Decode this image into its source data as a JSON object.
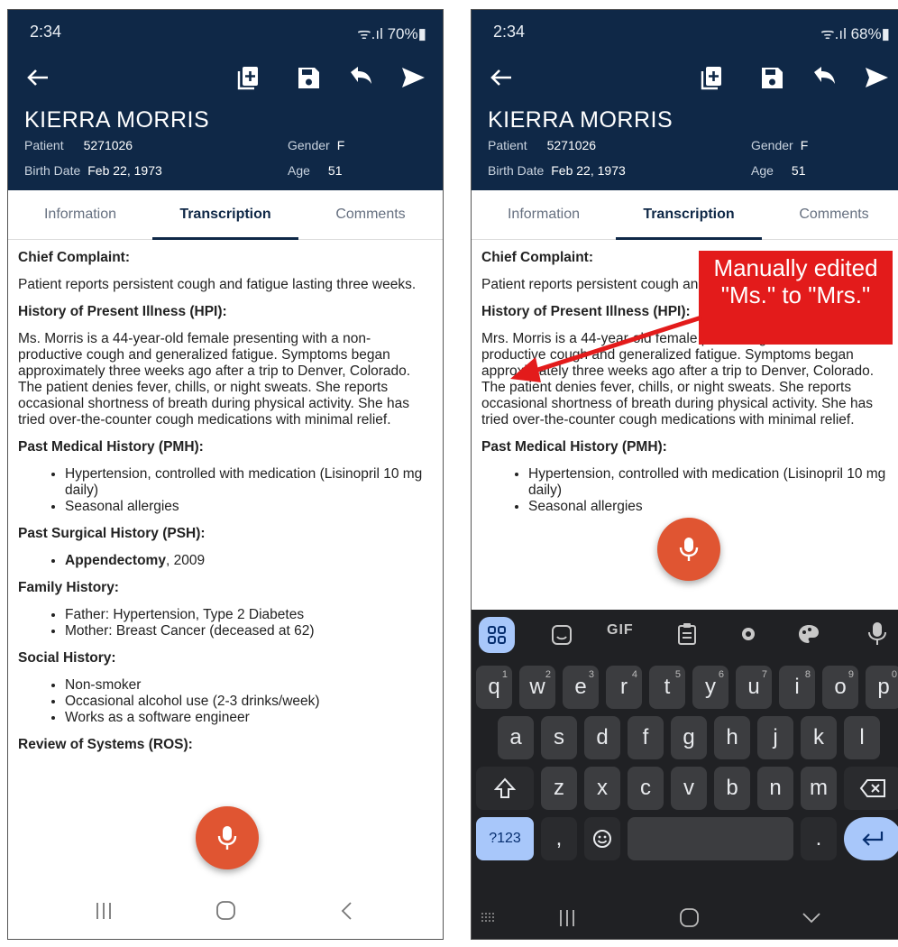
{
  "left": {
    "status": {
      "time": "2:34",
      "signal": "ᯤ.ıl 70%▮"
    },
    "fab_label": "Voice input"
  },
  "right": {
    "status": {
      "time": "2:34",
      "signal": "ᯤ.ıl 68%▮"
    }
  },
  "patient": {
    "name": "KIERRA MORRIS",
    "patient_label": "Patient",
    "patient_id": "5271026",
    "gender_label": "Gender",
    "gender": "F",
    "birth_label": "Birth Date",
    "birth_date": "Feb 22, 1973",
    "age_label": "Age",
    "age": "51"
  },
  "tabs": [
    "Information",
    "Transcription",
    "Comments"
  ],
  "note": {
    "cc_h": "Chief Complaint:",
    "cc": "Patient reports persistent cough and fatigue lasting three weeks.",
    "hpi_h": "History of Present Illness (HPI):",
    "hpi": "Ms. Morris is a 44-year-old female presenting with a non-productive cough and generalized fatigue. Symptoms began approximately three weeks ago after a trip to Denver, Colorado. The patient denies fever, chills, or night sweats. She reports occasional shortness of breath during physical activity. She has tried over-the-counter cough medications with minimal relief.",
    "hpi_edited": "Mrs. Morris is a 44-year-old female presenting with a non-productive cough and generalized fatigue. Symptoms began approximately three weeks ago after a trip to Denver, Colorado. The patient denies fever, chills, or night sweats. She reports occasional shortness of breath during physical activity. She has tried over-the-counter cough medications with minimal relief.",
    "pmh_h": "Past Medical History (PMH):",
    "pmh": [
      "Hypertension, controlled with medication (Lisinopril 10 mg daily)",
      "Seasonal allergies"
    ],
    "psh_h": "Past Surgical History (PSH):",
    "psh_bold": "Appendectomy",
    "psh_rest": ", 2009",
    "fh_h": "Family History:",
    "fh": [
      "Father: Hypertension, Type 2 Diabetes",
      "Mother: Breast Cancer (deceased at 62)"
    ],
    "sh_h": "Social History:",
    "sh": [
      "Non-smoker",
      "Occasional alcohol use (2-3 drinks/week)",
      "Works as a software engineer"
    ],
    "ros_h": "Review of Systems (ROS):"
  },
  "keyboard": {
    "toolbar": [
      "apps-grid",
      "sticker",
      "GIF",
      "clipboard",
      "settings",
      "palette",
      "mic"
    ],
    "gif_label": "GIF",
    "row1": [
      [
        "q",
        "1"
      ],
      [
        "w",
        "2"
      ],
      [
        "e",
        "3"
      ],
      [
        "r",
        "4"
      ],
      [
        "t",
        "5"
      ],
      [
        "y",
        "6"
      ],
      [
        "u",
        "7"
      ],
      [
        "i",
        "8"
      ],
      [
        "o",
        "9"
      ],
      [
        "p",
        "0"
      ]
    ],
    "row2": [
      "a",
      "s",
      "d",
      "f",
      "g",
      "h",
      "j",
      "k",
      "l"
    ],
    "row3": [
      "z",
      "x",
      "c",
      "v",
      "b",
      "n",
      "m"
    ],
    "sym_label": "?123",
    "comma": ",",
    "period": "."
  },
  "callout": {
    "text": "Manually edited \"Ms.\" to \"Mrs.\""
  },
  "colors": {
    "appbar": "#0f2847",
    "fab": "#e05532",
    "callout": "#e31b1b",
    "keyboard": "#202124",
    "enter_key": "#a8c7fa"
  }
}
